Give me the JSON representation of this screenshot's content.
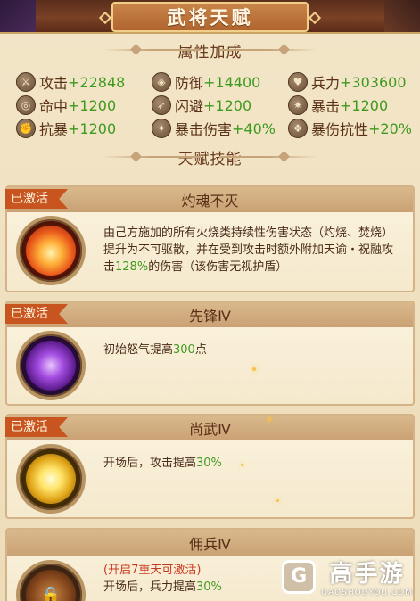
{
  "window": {
    "title": "武将天赋"
  },
  "sections": {
    "attributes_title": "属性加成",
    "skills_title": "天赋技能"
  },
  "attributes": [
    {
      "label": "攻击",
      "value": "+22848",
      "icon": "sword-icon"
    },
    {
      "label": "防御",
      "value": "+14400",
      "icon": "shield-icon"
    },
    {
      "label": "兵力",
      "value": "+303600",
      "icon": "heart-icon"
    },
    {
      "label": "命中",
      "value": "+1200",
      "icon": "target-icon"
    },
    {
      "label": "闪避",
      "value": "+1200",
      "icon": "dodge-icon"
    },
    {
      "label": "暴击",
      "value": "+1200",
      "icon": "crit-icon"
    },
    {
      "label": "抗暴",
      "value": "+1200",
      "icon": "anti-crit-icon"
    },
    {
      "label": "暴击伤害",
      "value": "+40%",
      "icon": "crit-damage-icon"
    },
    {
      "label": "暴伤抗性",
      "value": "+20%",
      "icon": "crit-resist-icon"
    }
  ],
  "skills": [
    {
      "status": "已激活",
      "name": "灼魂不灭",
      "desc_main": "由己方施加的所有火烧类持续性伤害状态（灼烧、焚烧）提升为不可驱散，并在受到攻击时额外附加天谕・祝融攻击",
      "desc_hl": "128%",
      "desc_tail": "的伤害（该伤害无视护盾）",
      "icon": "fire-skill-icon"
    },
    {
      "status": "已激活",
      "name": "先锋Ⅳ",
      "desc_main": "初始怒气提高",
      "desc_hl": "300",
      "desc_tail": "点",
      "icon": "rage-skill-icon"
    },
    {
      "status": "已激活",
      "name": "尚武Ⅳ",
      "desc_main": "开场后，攻击提高",
      "desc_hl": "30%",
      "desc_tail": "",
      "icon": "attack-skill-icon"
    },
    {
      "status": "",
      "name": "佣兵Ⅳ",
      "desc_lock": "(开启7重天可激活)",
      "desc_main": "开场后，兵力提高",
      "desc_hl": "30%",
      "desc_tail": "",
      "icon": "locked-skill-icon"
    }
  ],
  "watermark": {
    "name": "高手游",
    "url": "GAOSHOUYOU.COM",
    "logo": "G"
  },
  "colors": {
    "accent_green": "#3e9a1e",
    "badge_orange": "#c8541f",
    "lock_red": "#c8391e"
  }
}
